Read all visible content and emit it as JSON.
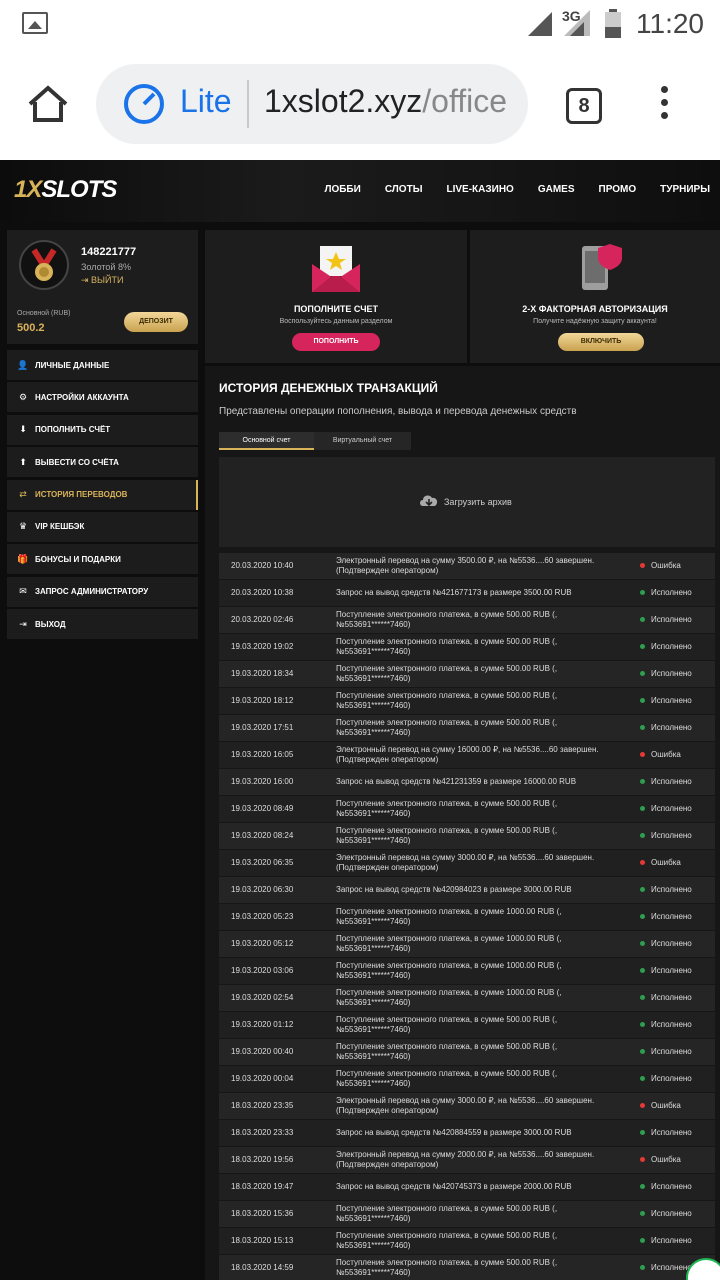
{
  "statusbar": {
    "network": "3G",
    "time": "11:20"
  },
  "browser": {
    "lite_label": "Lite",
    "url_domain": "1xslot2.xyz",
    "url_rest": "/office",
    "tab_count": "8"
  },
  "site": {
    "logo_prefix": "1X",
    "logo_suffix": "SLOTS",
    "nav": [
      "ЛОББИ",
      "СЛОТЫ",
      "LIVE-КАЗИНО",
      "GAMES",
      "ПРОМО",
      "ТУРНИРЫ"
    ]
  },
  "profile": {
    "user_id": "148221777",
    "level": "Золотой 8%",
    "exit": "ВЫЙТИ",
    "account_label": "Основной (RUB)",
    "balance": "500.2",
    "deposit_button": "ДЕПОЗИТ"
  },
  "menu": [
    {
      "label": "ЛИЧНЫЕ ДАННЫЕ",
      "icon": "user-add-icon",
      "glyph": "👤"
    },
    {
      "label": "НАСТРОЙКИ АККАУНТА",
      "icon": "gears-icon",
      "glyph": "⚙"
    },
    {
      "label": "ПОПОЛНИТЬ СЧЁТ",
      "icon": "download-icon",
      "glyph": "⬇"
    },
    {
      "label": "ВЫВЕСТИ СО СЧЁТА",
      "icon": "upload-icon",
      "glyph": "⬆"
    },
    {
      "label": "ИСТОРИЯ ПЕРЕВОДОВ",
      "icon": "transfer-icon",
      "glyph": "⇄",
      "active": true
    },
    {
      "label": "VIP КЕШБЭК",
      "icon": "crown-icon",
      "glyph": "♛"
    },
    {
      "label": "БОНУСЫ И ПОДАРКИ",
      "icon": "gift-icon",
      "glyph": "🎁"
    },
    {
      "label": "ЗАПРОС АДМИНИСТРАТОРУ",
      "icon": "envelope-icon",
      "glyph": "✉"
    },
    {
      "label": "ВЫХОД",
      "icon": "logout-icon",
      "glyph": "⇥"
    }
  ],
  "cards": {
    "deposit": {
      "title": "ПОПОЛНИТЕ СЧЕТ",
      "subtitle": "Воспользуйтесь данным разделом",
      "button": "ПОПОЛНИТЬ"
    },
    "twofa": {
      "title": "2-Х ФАКТОРНАЯ АВТОРИЗАЦИЯ",
      "subtitle": "Получите надёжную защиту аккаунта!",
      "button": "ВКЛЮЧИТЬ"
    }
  },
  "history": {
    "title": "ИСТОРИЯ ДЕНЕЖНЫХ ТРАНЗАКЦИЙ",
    "subtitle": "Представлены операции пополнения, вывода и перевода денежных средств",
    "tabs": [
      "Основной счет",
      "Виртуальный счет"
    ],
    "archive": "Загрузить архив"
  },
  "colors": {
    "accent": "#d9b35a",
    "error": "#e53935",
    "success": "#2e9e4f",
    "pink": "#d6245c"
  },
  "transactions": [
    {
      "date": "20.03.2020 10:40",
      "desc": "Электронный перевод на сумму 3500.00 ₽, на №5536....60 завершен. (Подтвержден оператором)",
      "status": "Ошибка",
      "ok": false
    },
    {
      "date": "20.03.2020 10:38",
      "desc": "Запрос на вывод средств №421677173 в размере 3500.00 RUB",
      "status": "Исполнено",
      "ok": true
    },
    {
      "date": "20.03.2020 02:46",
      "desc": "Поступление электронного платежа, в сумме 500.00 RUB (, №553691******7460)",
      "status": "Исполнено",
      "ok": true
    },
    {
      "date": "19.03.2020 19:02",
      "desc": "Поступление электронного платежа, в сумме 500.00 RUB (, №553691******7460)",
      "status": "Исполнено",
      "ok": true
    },
    {
      "date": "19.03.2020 18:34",
      "desc": "Поступление электронного платежа, в сумме 500.00 RUB (, №553691******7460)",
      "status": "Исполнено",
      "ok": true
    },
    {
      "date": "19.03.2020 18:12",
      "desc": "Поступление электронного платежа, в сумме 500.00 RUB (, №553691******7460)",
      "status": "Исполнено",
      "ok": true
    },
    {
      "date": "19.03.2020 17:51",
      "desc": "Поступление электронного платежа, в сумме 500.00 RUB (, №553691******7460)",
      "status": "Исполнено",
      "ok": true
    },
    {
      "date": "19.03.2020 16:05",
      "desc": "Электронный перевод на сумму 16000.00 ₽, на №5536....60 завершен. (Подтвержден оператором)",
      "status": "Ошибка",
      "ok": false
    },
    {
      "date": "19.03.2020 16:00",
      "desc": "Запрос на вывод средств №421231359 в размере 16000.00 RUB",
      "status": "Исполнено",
      "ok": true
    },
    {
      "date": "19.03.2020 08:49",
      "desc": "Поступление электронного платежа, в сумме 500.00 RUB (, №553691******7460)",
      "status": "Исполнено",
      "ok": true
    },
    {
      "date": "19.03.2020 08:24",
      "desc": "Поступление электронного платежа, в сумме 500.00 RUB (, №553691******7460)",
      "status": "Исполнено",
      "ok": true
    },
    {
      "date": "19.03.2020 06:35",
      "desc": "Электронный перевод на сумму 3000.00 ₽, на №5536....60 завершен. (Подтвержден оператором)",
      "status": "Ошибка",
      "ok": false
    },
    {
      "date": "19.03.2020 06:30",
      "desc": "Запрос на вывод средств №420984023 в размере 3000.00 RUB",
      "status": "Исполнено",
      "ok": true
    },
    {
      "date": "19.03.2020 05:23",
      "desc": "Поступление электронного платежа, в сумме 1000.00 RUB (, №553691******7460)",
      "status": "Исполнено",
      "ok": true
    },
    {
      "date": "19.03.2020 05:12",
      "desc": "Поступление электронного платежа, в сумме 1000.00 RUB (, №553691******7460)",
      "status": "Исполнено",
      "ok": true
    },
    {
      "date": "19.03.2020 03:06",
      "desc": "Поступление электронного платежа, в сумме 1000.00 RUB (, №553691******7460)",
      "status": "Исполнено",
      "ok": true
    },
    {
      "date": "19.03.2020 02:54",
      "desc": "Поступление электронного платежа, в сумме 1000.00 RUB (, №553691******7460)",
      "status": "Исполнено",
      "ok": true
    },
    {
      "date": "19.03.2020 01:12",
      "desc": "Поступление электронного платежа, в сумме 500.00 RUB (, №553691******7460)",
      "status": "Исполнено",
      "ok": true
    },
    {
      "date": "19.03.2020 00:40",
      "desc": "Поступление электронного платежа, в сумме 500.00 RUB (, №553691******7460)",
      "status": "Исполнено",
      "ok": true
    },
    {
      "date": "19.03.2020 00:04",
      "desc": "Поступление электронного платежа, в сумме 500.00 RUB (, №553691******7460)",
      "status": "Исполнено",
      "ok": true
    },
    {
      "date": "18.03.2020 23:35",
      "desc": "Электронный перевод на сумму 3000.00 ₽, на №5536....60 завершен. (Подтвержден оператором)",
      "status": "Ошибка",
      "ok": false
    },
    {
      "date": "18.03.2020 23:33",
      "desc": "Запрос на вывод средств №420884559 в размере 3000.00 RUB",
      "status": "Исполнено",
      "ok": true
    },
    {
      "date": "18.03.2020 19:56",
      "desc": "Электронный перевод на сумму 2000.00 ₽, на №5536....60 завершен. (Подтвержден оператором)",
      "status": "Ошибка",
      "ok": false
    },
    {
      "date": "18.03.2020 19:47",
      "desc": "Запрос на вывод средств №420745373 в размере 2000.00 RUB",
      "status": "Исполнено",
      "ok": true
    },
    {
      "date": "18.03.2020 15:36",
      "desc": "Поступление электронного платежа, в сумме 500.00 RUB (, №553691******7460)",
      "status": "Исполнено",
      "ok": true
    },
    {
      "date": "18.03.2020 15:13",
      "desc": "Поступление электронного платежа, в сумме 500.00 RUB (, №553691******7460)",
      "status": "Исполнено",
      "ok": true
    },
    {
      "date": "18.03.2020 14:59",
      "desc": "Поступление электронного платежа, в сумме 500.00 RUB (, №553691******7460)",
      "status": "Исполнено",
      "ok": true
    }
  ]
}
